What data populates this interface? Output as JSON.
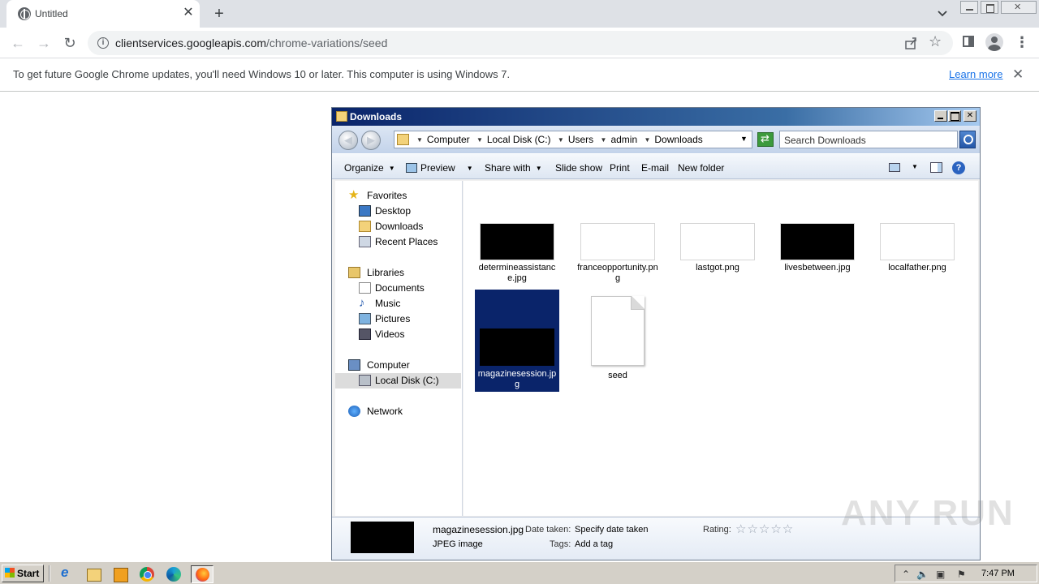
{
  "browser": {
    "tab_title": "Untitled",
    "url_host": "clientservices.googleapis.com",
    "url_path": "/chrome-variations/seed",
    "infobar_text": "To get future Google Chrome updates, you'll need Windows 10 or later. This computer is using Windows 7.",
    "infobar_link": "Learn more"
  },
  "explorer": {
    "title": "Downloads",
    "breadcrumbs": [
      "Computer",
      "Local Disk (C:)",
      "Users",
      "admin",
      "Downloads"
    ],
    "search_placeholder": "Search Downloads",
    "commands": {
      "organize": "Organize",
      "preview": "Preview",
      "share_with": "Share with",
      "slide_show": "Slide show",
      "print": "Print",
      "email": "E-mail",
      "new_folder": "New folder"
    },
    "nav": {
      "favorites": "Favorites",
      "desktop": "Desktop",
      "downloads": "Downloads",
      "recent_places": "Recent Places",
      "libraries": "Libraries",
      "documents": "Documents",
      "music": "Music",
      "pictures": "Pictures",
      "videos": "Videos",
      "computer": "Computer",
      "local_disk": "Local Disk (C:)",
      "network": "Network"
    },
    "files": [
      {
        "name": "determineassistance.jpg",
        "thumb": "black"
      },
      {
        "name": "franceopportunity.png",
        "thumb": "white"
      },
      {
        "name": "lastgot.png",
        "thumb": "white"
      },
      {
        "name": "livesbetween.jpg",
        "thumb": "black"
      },
      {
        "name": "localfather.png",
        "thumb": "white"
      },
      {
        "name": "magazinesession.jpg",
        "thumb": "black",
        "selected": true
      },
      {
        "name": "seed",
        "thumb": "document"
      }
    ],
    "details": {
      "name": "magazinesession.jpg",
      "type": "JPEG image",
      "date_taken_label": "Date taken:",
      "date_taken_value": "Specify date taken",
      "tags_label": "Tags:",
      "tags_value": "Add a tag",
      "rating_label": "Rating:",
      "rating_stars": "☆☆☆☆☆",
      "rating": 0
    }
  },
  "taskbar": {
    "start_label": "Start",
    "clock": "7:47 PM"
  },
  "watermark": "ANY RUN"
}
